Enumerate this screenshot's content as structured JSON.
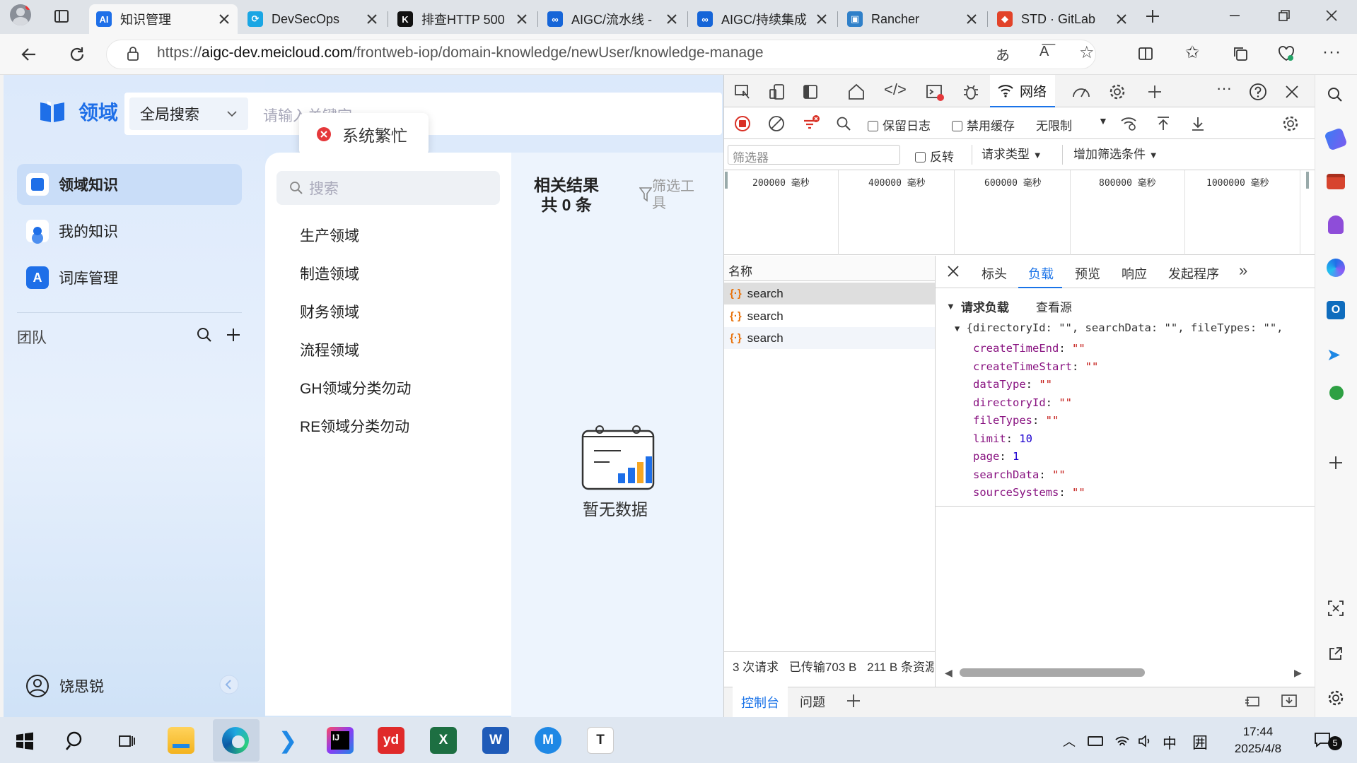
{
  "browser": {
    "tabs": [
      {
        "title": "知识管理",
        "active": true,
        "icon": "meicloud-icon"
      },
      {
        "title": "DevSecOps",
        "icon": "devsecops-icon"
      },
      {
        "title": "排查HTTP 500",
        "icon": "k-icon"
      },
      {
        "title": "AIGC/流水线 -",
        "icon": "infinity-icon"
      },
      {
        "title": "AIGC/持续集成",
        "icon": "infinity-icon"
      },
      {
        "title": "Rancher",
        "icon": "rancher-icon"
      },
      {
        "title": "STD · GitLab",
        "icon": "gitlab-icon"
      }
    ],
    "url_prefix": "https://",
    "url_host": "aigc-dev.meicloud.com",
    "url_path": "/frontweb-iop/domain-knowledge/newUser/knowledge-manage"
  },
  "app": {
    "logo_text": "领域",
    "search_scope": "全局搜索",
    "search_placeholder": "请输入关键字",
    "toast": "系统繁忙",
    "nav": [
      {
        "label": "领域知识",
        "selected": true
      },
      {
        "label": "我的知识"
      },
      {
        "label": "词库管理"
      }
    ],
    "team_label": "团队",
    "user_name": "饶思锐",
    "domain_search_placeholder": "搜索",
    "domains": [
      "生产领域",
      "制造领域",
      "财务领域",
      "流程领域",
      "GH领域分类勿动",
      "RE领域分类勿动"
    ],
    "results_title": "相关结果",
    "results_count": "共 0 条",
    "filter_label": "筛选工具",
    "empty_text": "暂无数据"
  },
  "devtools": {
    "network_tab": "网络",
    "preserve_log": "保留日志",
    "disable_cache": "禁用缓存",
    "throttle": "无限制",
    "filter_placeholder": "筛选器",
    "invert": "反转",
    "request_type": "请求类型",
    "more_filters": "增加筛选条件",
    "timeline_ticks": [
      "200000 毫秒",
      "400000 毫秒",
      "600000 毫秒",
      "800000 毫秒",
      "1000000 毫秒"
    ],
    "name_header": "名称",
    "requests": [
      "search",
      "search",
      "search"
    ],
    "detail_tabs": [
      "标头",
      "负载",
      "预览",
      "响应",
      "发起程序"
    ],
    "active_detail_tab": "负载",
    "payload_title": "请求负载",
    "view_source": "查看源",
    "payload_summary": "{directoryId: \"\", searchData: \"\", fileTypes: \"\",",
    "payload_fields": [
      {
        "key": "createTimeEnd",
        "value": "\"\""
      },
      {
        "key": "createTimeStart",
        "value": "\"\""
      },
      {
        "key": "dataType",
        "value": "\"\""
      },
      {
        "key": "directoryId",
        "value": "\"\""
      },
      {
        "key": "fileTypes",
        "value": "\"\""
      },
      {
        "key": "limit",
        "value": "10"
      },
      {
        "key": "page",
        "value": "1"
      },
      {
        "key": "searchData",
        "value": "\"\""
      },
      {
        "key": "sourceSystems",
        "value": "\"\""
      }
    ],
    "status_requests": "3 次请求",
    "status_transferred": "已传输703 B",
    "status_resources": "211 B 条资源",
    "drawer_tabs": [
      "控制台",
      "问题"
    ]
  },
  "taskbar": {
    "ime": "中",
    "time": "17:44",
    "date": "2025/4/8",
    "notifications": "5"
  },
  "colors": {
    "accent": "#1e6fe8",
    "page_bg": "#e3edfb",
    "error": "#e5383b",
    "devtools_link": "#1a73e8"
  }
}
